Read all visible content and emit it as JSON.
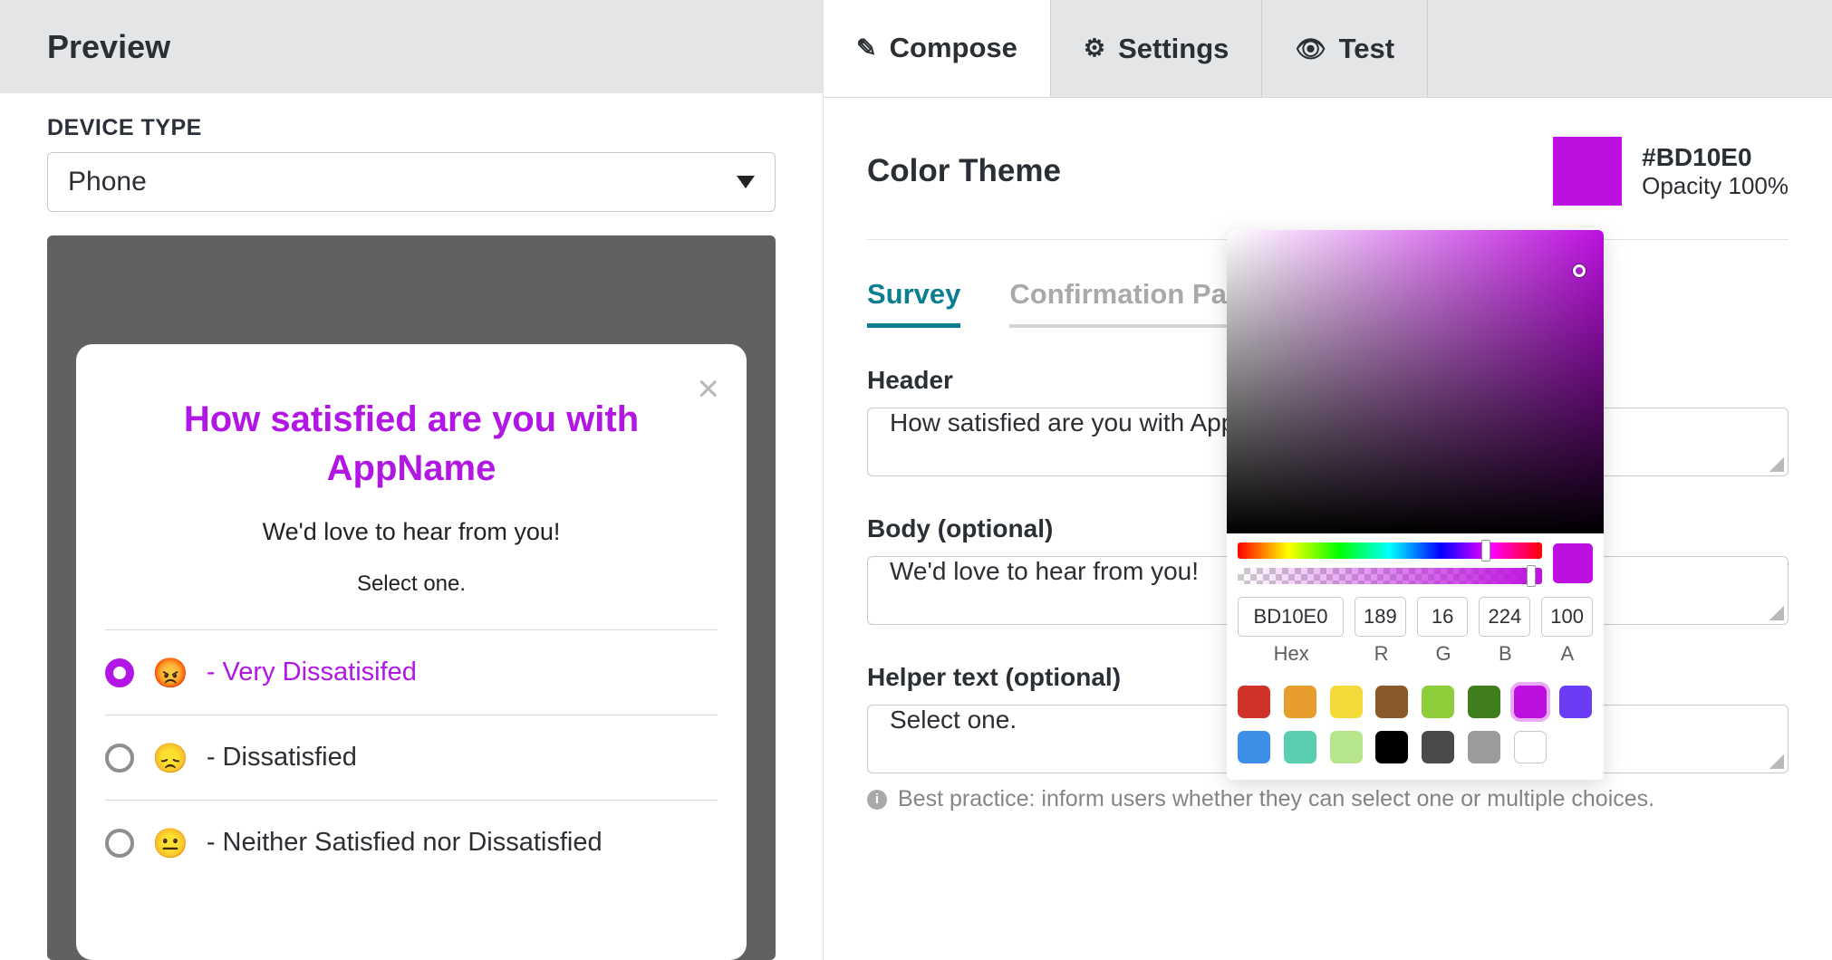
{
  "preview_panel": {
    "title": "Preview",
    "device_type_label": "DEVICE TYPE",
    "device_type_value": "Phone"
  },
  "survey_card": {
    "header": "How satisfied are you with AppName",
    "body": "We'd love to hear from you!",
    "helper": "Select one.",
    "options": [
      {
        "emoji": "😡",
        "text": "- Very Dissatisifed",
        "selected": true
      },
      {
        "emoji": "😞",
        "text": "- Dissatisfied",
        "selected": false
      },
      {
        "emoji": "😐",
        "text": "- Neither Satisfied nor Dissatisfied",
        "selected": false
      }
    ]
  },
  "main_tabs": [
    {
      "label": "Compose",
      "icon": "pencil-icon",
      "active": true
    },
    {
      "label": "Settings",
      "icon": "gear-icon",
      "active": false
    },
    {
      "label": "Test",
      "icon": "eye-icon",
      "active": false
    }
  ],
  "color_theme": {
    "title": "Color Theme",
    "hex_display": "#BD10E0",
    "opacity_display": "Opacity 100%",
    "swatch_color": "#BD10E0"
  },
  "sub_tabs": [
    {
      "label": "Survey",
      "active": true
    },
    {
      "label": "Confirmation Page",
      "active": false
    }
  ],
  "fields": {
    "header_label": "Header",
    "header_value": "How satisfied are you with AppName",
    "body_label": "Body (optional)",
    "body_value": "We'd love to hear from you!",
    "helper_label": "Helper text (optional)",
    "helper_value": "Select one.",
    "best_practice": "Best practice: inform users whether they can select one or multiple choices."
  },
  "color_picker": {
    "hex": "BD10E0",
    "r": "189",
    "g": "16",
    "b": "224",
    "a": "100",
    "labels": {
      "hex": "Hex",
      "r": "R",
      "g": "G",
      "b": "B",
      "a": "A"
    },
    "preset_swatches": [
      "#d0332a",
      "#e79c2e",
      "#f4d93a",
      "#8a5a2b",
      "#8fce3b",
      "#3f7e1d",
      "#bd10e0",
      "#6a3cf5",
      "#3d8ee6",
      "#59cfb0",
      "#b7e58c",
      "#000000",
      "#4a4a4a",
      "#9b9b9b",
      "#ffffff"
    ],
    "selected_swatch_index": 6
  }
}
